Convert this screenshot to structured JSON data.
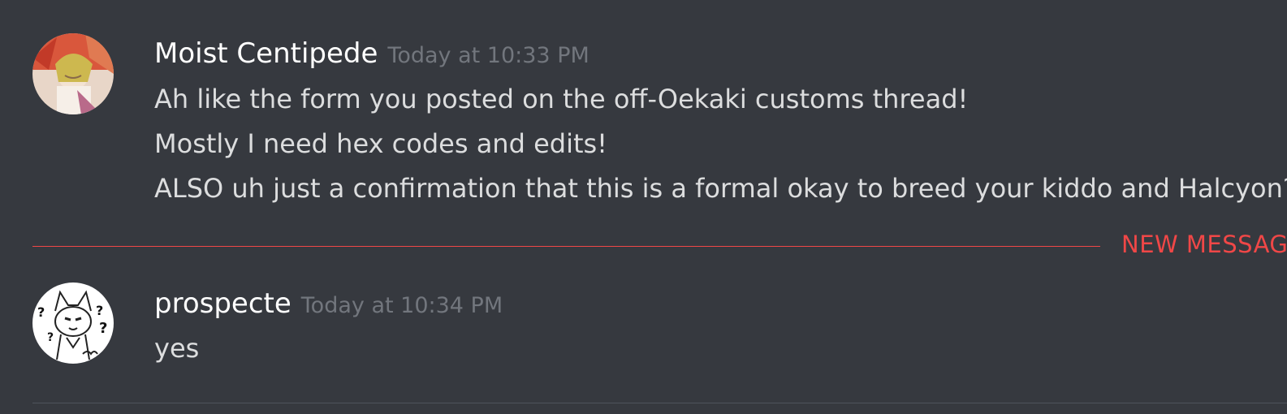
{
  "messages": [
    {
      "username": "Moist Centipede",
      "timestamp": "Today at 10:33 PM",
      "avatar_icon": "anime-character-avatar",
      "lines": [
        "Ah like the form you posted on the off-Oekaki customs thread!",
        "Mostly I need hex codes and edits!",
        "ALSO uh just a confirmation that this is a formal okay to breed your kiddo and Halcyon?"
      ]
    },
    {
      "username": "prospecte",
      "timestamp": "Today at 10:34 PM",
      "avatar_icon": "sketch-cat-avatar",
      "lines": [
        "yes"
      ]
    }
  ],
  "new_messages_divider": {
    "label": "NEW MESSAGES",
    "color": "#f04747"
  },
  "colors": {
    "background": "#36393f",
    "username": "#ffffff",
    "timestamp": "#72767d",
    "message_text": "#dcddde"
  }
}
